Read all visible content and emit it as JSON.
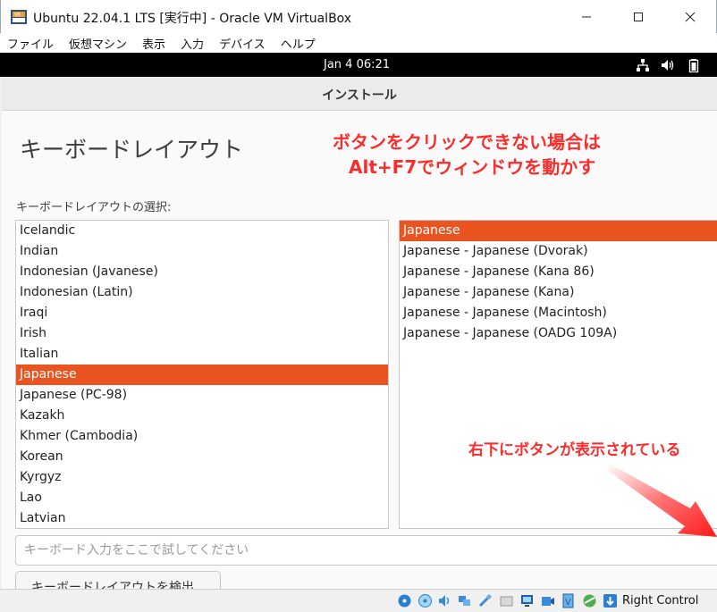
{
  "window": {
    "title": "Ubuntu 22.04.1 LTS [実行中] - Oracle VM VirtualBox",
    "app_icon": "virtualbox-icon"
  },
  "menubar": {
    "items": [
      "ファイル",
      "仮想マシン",
      "表示",
      "入力",
      "デバイス",
      "ヘルプ"
    ]
  },
  "topbar": {
    "clock": "Jan 4  06:21",
    "icons": [
      "network-icon",
      "volume-icon",
      "battery-icon"
    ]
  },
  "installer": {
    "header_title": "インストール",
    "page_title": "キーボードレイアウト",
    "section_label": "キーボードレイアウトの選択:",
    "layouts": [
      "Icelandic",
      "Indian",
      "Indonesian (Javanese)",
      "Indonesian (Latin)",
      "Iraqi",
      "Irish",
      "Italian",
      "Japanese",
      "Japanese (PC-98)",
      "Kazakh",
      "Khmer (Cambodia)",
      "Korean",
      "Kyrgyz",
      "Lao",
      "Latvian"
    ],
    "selected_layout_index": 7,
    "variants": [
      "Japanese",
      "Japanese - Japanese (Dvorak)",
      "Japanese - Japanese (Kana 86)",
      "Japanese - Japanese (Kana)",
      "Japanese - Japanese (Macintosh)",
      "Japanese - Japanese (OADG 109A)"
    ],
    "selected_variant_index": 0,
    "test_placeholder": "キーボード入力をここで試してください",
    "detect_button": "キーボードレイアウトを検出"
  },
  "annotations": {
    "line1": "ボタンをクリックできない場合は",
    "line2": "Alt+F7でウィンドウを動かす",
    "line3": "右下にボタンが表示されている",
    "color": "#ff2a2a"
  },
  "statusbar": {
    "host_key": "Right Control"
  },
  "colors": {
    "accent": "#e95420",
    "topbar": "#000000"
  }
}
